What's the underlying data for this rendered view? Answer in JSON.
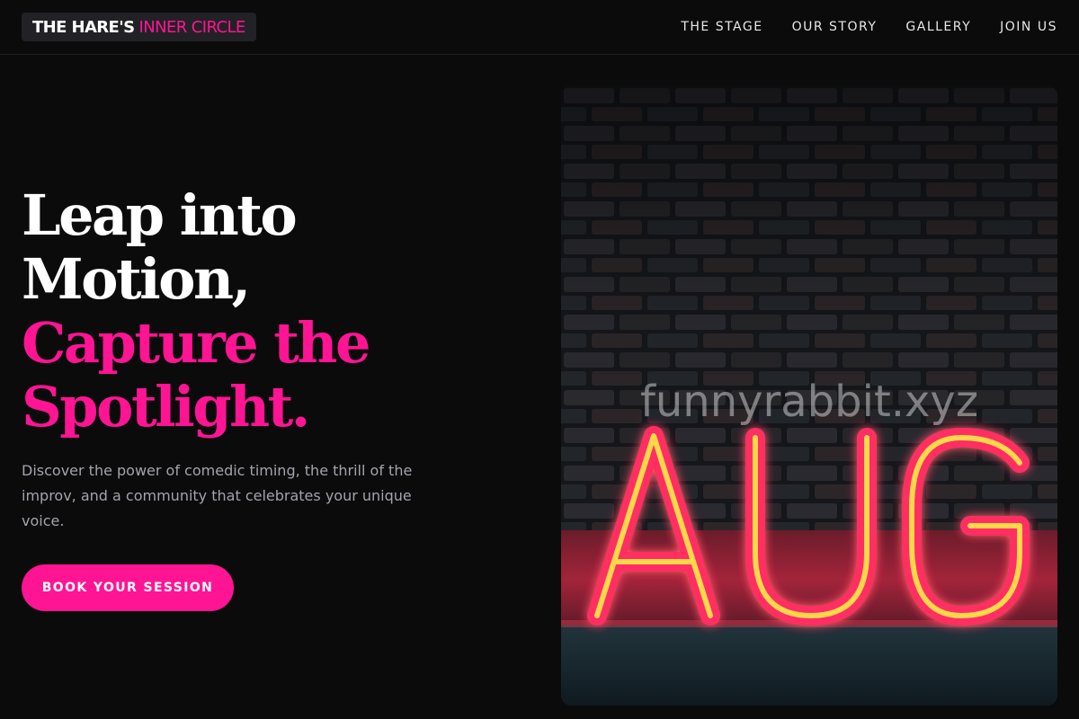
{
  "header": {
    "logo_main": "THE HARE'S",
    "logo_accent": "INNER CIRCLE",
    "nav": [
      "THE STAGE",
      "OUR STORY",
      "GALLERY",
      "JOIN US"
    ]
  },
  "hero": {
    "headline_lines": [
      "Leap into",
      "Motion,",
      "Capture the",
      "Spotlight."
    ],
    "description": "Discover the power of comedic timing, the thrill of the improv, and a community that celebrates your unique voice.",
    "cta_label": "BOOK YOUR SESSION"
  },
  "image": {
    "watermark": "funnyrabbit.xyz",
    "neon_text": "AUG"
  },
  "colors": {
    "accent": "#ff1493",
    "background": "#0b0b0c",
    "neon_tube": "#ffd84a",
    "neon_outer": "#ff2e63"
  }
}
